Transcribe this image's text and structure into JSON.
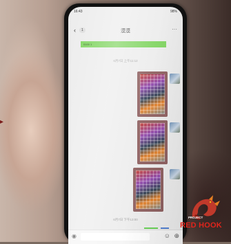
{
  "status": {
    "time": "16:43",
    "right": "98%"
  },
  "nav": {
    "back_badge": "1",
    "title": "漠漠",
    "more": "···"
  },
  "green_message": {
    "text": "0100 1"
  },
  "timestamps": [
    "6月7日 上午11:12",
    "6月7日 下午13:00"
  ],
  "images": [
    {
      "description_name": "crossword-photo-1"
    },
    {
      "description_name": "crossword-photo-2"
    },
    {
      "description_name": "crossword-photo-3"
    }
  ],
  "colors": {
    "accent_green": "#7bd35a",
    "watermark_red": "#e0241b"
  },
  "watermark": {
    "project": "PROJECT",
    "red_hook": "RED HOOK"
  }
}
